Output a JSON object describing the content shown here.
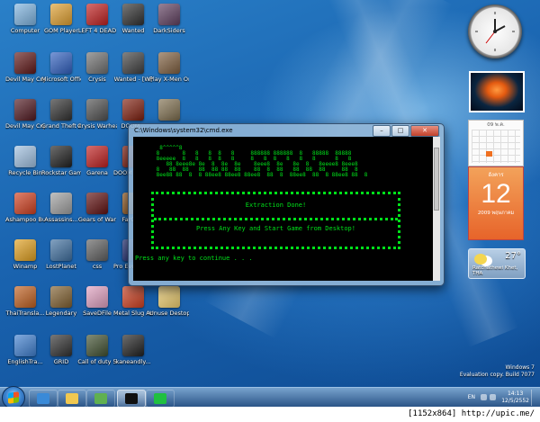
{
  "desktop": {
    "icons": [
      {
        "label": "Computer",
        "icon": "computer-icon",
        "color": "#7fb4e0"
      },
      {
        "label": "GOM Player",
        "icon": "gom-player-icon",
        "color": "#e0a030"
      },
      {
        "label": "LEFT 4 DEAD",
        "icon": "left4dead-icon",
        "color": "#c02020"
      },
      {
        "label": "Wanted",
        "icon": "wanted-icon",
        "color": "#303030"
      },
      {
        "label": "DarkSiders",
        "icon": "darksiders-icon",
        "color": "#604060"
      },
      {
        "label": "Devil May Cry4 [DX9]",
        "icon": "devil-may-cry-icon",
        "color": "#601818"
      },
      {
        "label": "Microsoft Office Wo...",
        "icon": "word-icon",
        "color": "#3060c0"
      },
      {
        "label": "Crysis",
        "icon": "crysis-icon",
        "color": "#707070"
      },
      {
        "label": "Wanted - [W]",
        "icon": "wanted-icon",
        "color": "#404040"
      },
      {
        "label": "Play X-Men Origins - ...",
        "icon": "xmen-icon",
        "color": "#806040"
      },
      {
        "label": "Devil May Cry4 [DX10]",
        "icon": "devil-may-cry-icon",
        "color": "#501820"
      },
      {
        "label": "Grand Theft Auto IV",
        "icon": "gta4-icon",
        "color": "#303030"
      },
      {
        "label": "Crysis Warhead",
        "icon": "crysis-icon",
        "color": "#505050"
      },
      {
        "label": "DOOM...",
        "icon": "doom-icon",
        "color": "#802010"
      },
      {
        "label": "",
        "icon": "game-icon",
        "color": "#807050"
      },
      {
        "label": "Recycle Bin",
        "icon": "recycle-bin-icon",
        "color": "#a0c0e0"
      },
      {
        "label": "Rockstar Games Soci...",
        "icon": "rockstar-icon",
        "color": "#202020"
      },
      {
        "label": "Garena",
        "icon": "garena-icon",
        "color": "#c02020"
      },
      {
        "label": "DOOM Resurre...",
        "icon": "doom-icon",
        "color": "#902010"
      },
      {
        "label": "Ashampoo Burning ...",
        "icon": "ashampoo-icon",
        "color": "#d04020"
      },
      {
        "label": "Assassins...",
        "icon": "assassins-creed-icon",
        "color": "#a0a0a0"
      },
      {
        "label": "Gears of War",
        "icon": "gears-of-war-icon",
        "color": "#601010"
      },
      {
        "label": "FarCry2",
        "icon": "farcry-icon",
        "color": "#a06020"
      },
      {
        "label": "Winamp",
        "icon": "winamp-icon",
        "color": "#e0a020"
      },
      {
        "label": "LostPlanet",
        "icon": "lostplanet-icon",
        "color": "#4070a0"
      },
      {
        "label": "css",
        "icon": "counter-strike-icon",
        "color": "#606060"
      },
      {
        "label": "Pro Evolu... 2009",
        "icon": "pes-icon",
        "color": "#203080"
      },
      {
        "label": "ThaiTransla...",
        "icon": "thaitranslator-icon",
        "color": "#c06020"
      },
      {
        "label": "Legendary",
        "icon": "legendary-icon",
        "color": "#806030"
      },
      {
        "label": "SaveDFile",
        "icon": "savedfile-icon",
        "color": "#e0a0c0"
      },
      {
        "label": "Metal Slug Anthology",
        "icon": "metal-slug-icon",
        "color": "#d04020"
      },
      {
        "label": "Unuse Destop",
        "icon": "folder-icon",
        "color": "#f0d070"
      },
      {
        "label": "EnglishTra...",
        "icon": "englishtranslator-icon",
        "color": "#4080d0"
      },
      {
        "label": "GRID",
        "icon": "grid-icon",
        "color": "#303030"
      },
      {
        "label": "Call of duty 5",
        "icon": "call-of-duty-icon",
        "color": "#405030"
      },
      {
        "label": "kaneandly...",
        "icon": "kane-lynch-icon",
        "color": "#202020"
      }
    ]
  },
  "cmd_window": {
    "title": "C:\\Windows\\system32\\cmd.exe",
    "ascii_art": "  8^^^^^8\n 8       8   8   8  8   8     888888 888888  8   88888  88888\n 8eeeee  8   8   8  8   8     8   8  8   8   8   8      8   8\n    88 8eee8e 8e  8  8e  8e    8eee8  8e   8e  8   8eeee8 8eee8\n 8   88  88   88  88 88  88    88  8  88   88  88  88     88  8\n 8ee88 88  8  8 88ee8 88ee8 88ee8  88  8  88ee8  88  8 88ee8 88  8",
    "box_title": "Extraction Done!",
    "box_message": "Press Any Key and Start Game from Desktop!",
    "prompt": "Press any key to continue . . ."
  },
  "gadgets": {
    "calendar": {
      "month_label": "09 พ.ค.",
      "day_name": "อังคาร",
      "day_number": "12",
      "year_month": "2009 พฤษภาคม"
    },
    "weather": {
      "temperature": "27°",
      "location": "Ratchathewi Khet, THA"
    }
  },
  "watermark": {
    "line1": "Windows 7",
    "line2": "Evaluation copy. Build 7077"
  },
  "taskbar": {
    "apps": [
      {
        "name": "internet-explorer-icon",
        "color": "#3a8ad8"
      },
      {
        "name": "windows-explorer-icon",
        "color": "#f0c850"
      },
      {
        "name": "network-icon",
        "color": "#60b050"
      },
      {
        "name": "cmd-icon",
        "color": "#101010"
      },
      {
        "name": "play-arrow-icon",
        "color": "#20c040"
      }
    ],
    "language": "EN",
    "time": "14:13",
    "date": "12/5/2552"
  },
  "footer": {
    "text": "[1152x864] http://upic.me/"
  }
}
